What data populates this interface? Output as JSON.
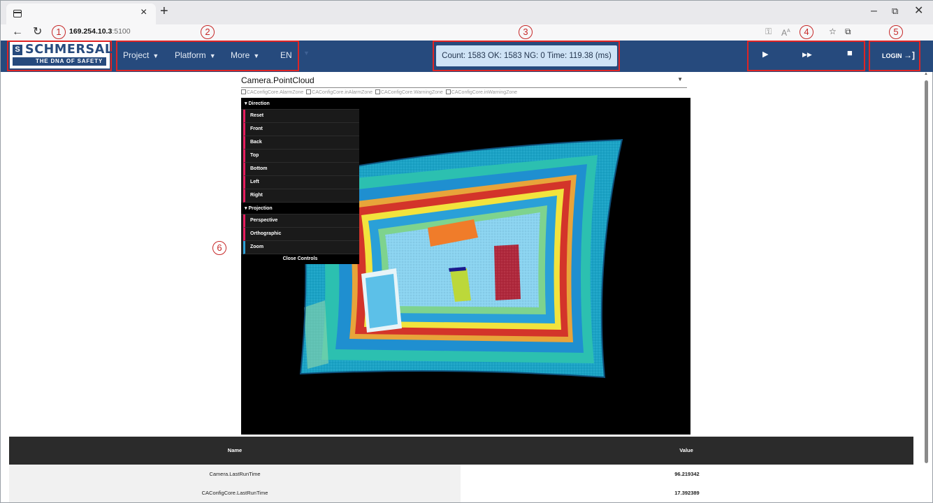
{
  "browser": {
    "tab_close": "×",
    "new_tab": "+",
    "url_host": "169.254.10.3",
    "url_port": ":5100"
  },
  "annotations": [
    "1",
    "2",
    "3",
    "4",
    "5",
    "6"
  ],
  "header": {
    "logo_mark": "S",
    "logo_word": "SCHMERSAL",
    "logo_tagline": "THE DNA OF SAFETY",
    "menu": [
      "Project",
      "Platform",
      "More"
    ],
    "language": "EN",
    "counter": "Count:  1583  OK:  1583  NG:  0  Time:  119.38  (ms)",
    "login_label": "LOGIN"
  },
  "view": {
    "selected": "Camera.PointCloud",
    "zones": [
      "CAConfigCore.AlarmZone",
      "CAConfigCore.inAlarmZone",
      "CAConfigCore.WarningZone",
      "CAConfigCore.inWarningZone"
    ]
  },
  "controls": {
    "direction_title": "Direction",
    "direction_items": [
      "Reset",
      "Front",
      "Back",
      "Top",
      "Bottom",
      "Left",
      "Right"
    ],
    "projection_title": "Projection",
    "projection_items": [
      "Perspective",
      "Orthographic",
      "Zoom"
    ],
    "close_label": "Close Controls"
  },
  "table": {
    "headers": [
      "Name",
      "Value"
    ],
    "rows": [
      {
        "name": "Camera.LastRunTime",
        "value": "96.219342"
      },
      {
        "name": "CAConfigCore.LastRunTime",
        "value": "17.392389"
      }
    ]
  },
  "colors": {
    "header_bg": "#264a7d",
    "highlight_red": "#e02424",
    "counter_bg": "#cfe3f6"
  }
}
